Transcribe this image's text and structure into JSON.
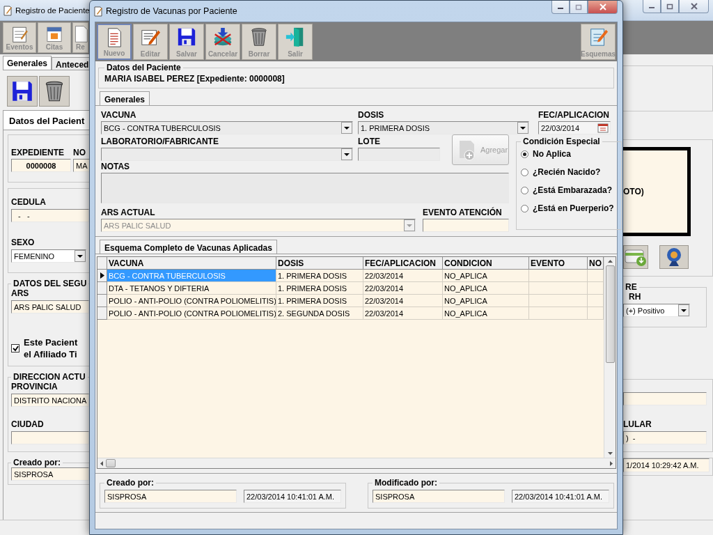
{
  "main_window": {
    "title": "Registro de Paciente",
    "toolbar": [
      {
        "label": "Eventos",
        "kind": "notepad"
      },
      {
        "label": "Citas",
        "kind": "calendar"
      },
      {
        "label": "Re",
        "kind": "document"
      }
    ],
    "tabs": [
      {
        "label": "Generales",
        "selected": true
      },
      {
        "label": "Anteced",
        "selected": false
      }
    ],
    "section_tab": "Datos del Pacient",
    "expediente": {
      "label": "EXPEDIENTE",
      "value": "0000008"
    },
    "nombre": {
      "label": "NO",
      "value": "MA"
    },
    "cedula": {
      "label": "CEDULA",
      "value": "-   -"
    },
    "sexo": {
      "label": "SEXO",
      "value": "FEMENINO"
    },
    "seguro": {
      "title": "DATOS DEL SEGU",
      "ars_label": "ARS",
      "ars_value": "ARS PALIC SALUD"
    },
    "afiliado": {
      "lines": [
        "Este Pacient",
        "el Afiliado Ti"
      ],
      "checked": true
    },
    "direccion": {
      "title": "DIRECCION ACTU",
      "provincia_label": "PROVINCIA",
      "provincia_value": "DISTRITO NACIONA",
      "ciudad_label": "CIUDAD"
    },
    "creado": {
      "title": "Creado por:",
      "value": "SISPROSA"
    },
    "photo_text": "OTO)",
    "sangre": {
      "title": "RE",
      "rh_label": "RH",
      "rh_value": "(+) Positivo"
    },
    "celular": {
      "label": "LULAR",
      "value": ")  -"
    },
    "fecha_modificado": "1/2014 10:29:42 A.M."
  },
  "dialog": {
    "title": "Registro de Vacunas por Paciente",
    "toolbar": [
      {
        "label": "Nuevo",
        "kind": "new",
        "selected": true
      },
      {
        "label": "Editar",
        "kind": "edit",
        "selected": false
      },
      {
        "label": "Salvar",
        "kind": "save",
        "selected": false
      },
      {
        "label": "Cancelar",
        "kind": "cancel",
        "selected": false
      },
      {
        "label": "Borrar",
        "kind": "delete",
        "selected": false
      },
      {
        "label": "Salir",
        "kind": "exit",
        "selected": false
      }
    ],
    "esquemas": {
      "label": "Esquemas"
    },
    "patient": {
      "title": "Datos del Paciente",
      "text": "MARIA ISABEL PEREZ [Expediente: 0000008]"
    },
    "form_tab": "Generales",
    "vacuna": {
      "label": "VACUNA",
      "value": "BCG - CONTRA TUBERCULOSIS"
    },
    "dosis": {
      "label": "DOSIS",
      "value": "1. PRIMERA DOSIS"
    },
    "fecha": {
      "label": "FEC/APLICACION",
      "value": "22/03/2014"
    },
    "laboratorio": {
      "label": "LABORATORIO/FABRICANTE"
    },
    "lote": {
      "label": "LOTE"
    },
    "agregar": {
      "label": "Agregar",
      "disabled": true
    },
    "notas": {
      "label": "NOTAS"
    },
    "ars": {
      "label": "ARS ACTUAL",
      "value": "ARS PALIC SALUD",
      "disabled": true
    },
    "evento": {
      "label": "EVENTO ATENCIÓN"
    },
    "condicion": {
      "title": "Condición Especial",
      "options": [
        {
          "label": "No Aplica",
          "selected": true
        },
        {
          "label": "¿Recién Nacido?",
          "selected": false
        },
        {
          "label": "¿Está Embarazada?",
          "selected": false
        },
        {
          "label": "¿Está en Puerperio?",
          "selected": false
        }
      ]
    },
    "grid_tab": "Esquema Completo de Vacunas Aplicadas",
    "grid": {
      "columns": [
        "VACUNA",
        "DOSIS",
        "FEC/APLICACION",
        "CONDICION",
        "EVENTO",
        "NO"
      ],
      "rows": [
        {
          "cells": [
            "BCG - CONTRA TUBERCULOSIS",
            "1. PRIMERA DOSIS",
            "22/03/2014",
            "NO_APLICA"
          ],
          "selected": true
        },
        {
          "cells": [
            "DTA - TETANOS Y DIFTERIA",
            "1. PRIMERA DOSIS",
            "22/03/2014",
            "NO_APLICA"
          ],
          "selected": false
        },
        {
          "cells": [
            "POLIO - ANTI-POLIO (CONTRA POLIOMELITIS)",
            "1. PRIMERA DOSIS",
            "22/03/2014",
            "NO_APLICA"
          ],
          "selected": false
        },
        {
          "cells": [
            "POLIO - ANTI-POLIO (CONTRA POLIOMELITIS)",
            "2. SEGUNDA DOSIS",
            "22/03/2014",
            "NO_APLICA"
          ],
          "selected": false
        }
      ]
    },
    "creado": {
      "title": "Creado por:",
      "user": "SISPROSA",
      "date": "22/03/2014 10:41:01 A.M."
    },
    "modificado": {
      "title": "Modificado por:",
      "user": "SISPROSA",
      "date": "22/03/2014 10:41:01 A.M."
    }
  }
}
